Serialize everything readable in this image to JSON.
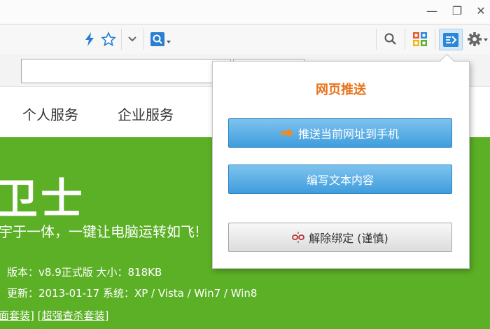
{
  "window": {
    "minimize_glyph": "—",
    "restore_glyph": "❐",
    "close_glyph": "✕"
  },
  "toolbar": {
    "icons": [
      "lightning-icon",
      "star-icon",
      "chevron-down-icon",
      "search-engine-icon",
      "search-icon",
      "apps-grid-icon",
      "push-to-phone-icon",
      "gear-icon"
    ],
    "accent": "#2a7fd1"
  },
  "nav": {
    "items": [
      "个人服务",
      "企业服务"
    ]
  },
  "hero": {
    "title": "卫士",
    "tagline": "宇于一体，一键让电脑运转如飞!",
    "version_line": "版本：v8.9正式版   大小：818KB",
    "update_line": "更新：2013-01-17   系统：XP / Vista / Win7 / Win8",
    "link1": "面套装]",
    "link2": "[超强查杀套装]",
    "bg": "#5cb025"
  },
  "popup": {
    "title": "网页推送",
    "push_url_button": "推送当前网址到手机",
    "write_text_button": "编写文本内容",
    "unbind_button": "解除绑定 (谨慎)",
    "title_color": "#e8731d"
  }
}
